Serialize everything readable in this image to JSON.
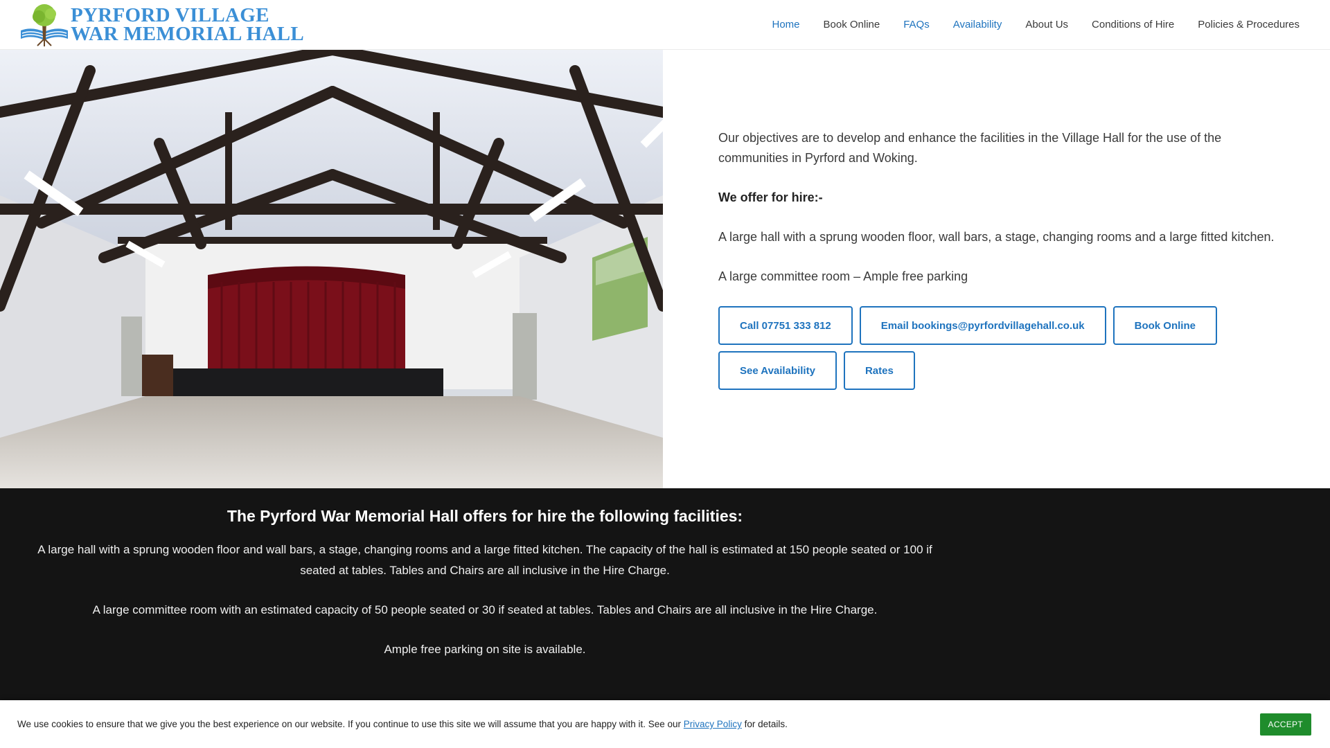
{
  "brand": {
    "line1": "PYRFORD VILLAGE",
    "line2": "WAR MEMORIAL HALL",
    "logo_icon": "tree-book-logo",
    "color": "#3b8fd6"
  },
  "nav": {
    "items": [
      {
        "label": "Home",
        "active": true
      },
      {
        "label": "Book Online",
        "active": false
      },
      {
        "label": "FAQs",
        "active": true
      },
      {
        "label": "Availability",
        "active": true
      },
      {
        "label": "About Us",
        "active": false
      },
      {
        "label": "Conditions of Hire",
        "active": false
      },
      {
        "label": "Policies & Procedures",
        "active": false
      }
    ],
    "accent_color": "#1e73be"
  },
  "hero": {
    "paragraph1": "Our objectives are to develop and enhance the facilities in the Village Hall for the use of the communities in Pyrford and Woking.",
    "offer_heading": "We offer for hire:-",
    "paragraph2": "A large hall with a sprung wooden floor, wall bars, a stage, changing rooms and a large fitted kitchen.",
    "paragraph3": "A large committee room – Ample free parking",
    "buttons": [
      "Call 07751 333 812",
      "Email bookings@pyrfordvillagehall.co.uk",
      "Book Online",
      "See Availability",
      "Rates"
    ]
  },
  "facilities": {
    "heading": "The Pyrford War Memorial Hall offers for hire the following facilities:",
    "paragraph1": "A large hall with a sprung wooden floor and wall bars, a stage, changing rooms and a large fitted kitchen. The capacity of the hall is estimated at 150 people seated or 100 if seated at tables. Tables and Chairs are all inclusive in the Hire Charge.",
    "paragraph2": "A large committee room with an estimated capacity of 50 people seated or 30 if seated at tables. Tables and Chairs are all inclusive in the Hire Charge.",
    "paragraph3": "Ample free parking on site is available.",
    "background": "#141414"
  },
  "cookie": {
    "text_before": "We use cookies to ensure that we give you the best experience on our website. If you continue to use this site we will assume that you are happy with it. See our ",
    "link_label": "Privacy Policy",
    "text_after": " for details.",
    "accept_label": "ACCEPT",
    "accept_color": "#1f8c2c"
  }
}
